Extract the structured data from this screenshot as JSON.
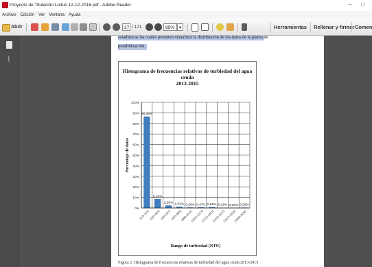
{
  "window": {
    "title": "Proyecto de Titulación Loduo 12-12-2016.pdf - Adobe Reader",
    "minimize": "–",
    "maximize": "□"
  },
  "menu": [
    "Archivo",
    "Edición",
    "Ver",
    "Ventana",
    "Ayuda"
  ],
  "toolbar": {
    "open_label": "Abrir",
    "page_current": "27",
    "page_total": "/ 171",
    "zoom": "85%",
    "tools_label": "Herramientas",
    "sign_label": "Rellenar y firmar",
    "comment_label": "Comenta"
  },
  "document": {
    "line1": "estadísticas las cuales permiten visualizar la distribución de los datos de la planta de",
    "line2": "potabilización.",
    "caption": "Figura 2. Histograma de frecuencias relativas de turbiedad del agua cruda 2013-2015"
  },
  "chart_data": {
    "type": "bar",
    "title": "Histograma de frecuencias relativas de turbiedad del agua cruda 2013-2015",
    "title_lines": [
      "Histograma de frecuencias relativas de turbiedad del agua cruda",
      "2013-2015"
    ],
    "xlabel": "Rango de turbiedad (NTU)",
    "ylabel": "Porcentaje de datos",
    "categories": [
      "[0,8-203]",
      "[203-405]",
      "[405-607]",
      "[607-809]",
      "[809-1011]",
      "[1011-1213]",
      "[1213-1415]",
      "[1415-1617]",
      "[1617-1819]",
      "[1819-2024]"
    ],
    "values": [
      86.38,
      8.26,
      2.25,
      1.03,
      0.38,
      0.47,
      0.66,
      0.19,
      0.09,
      0.28
    ],
    "value_labels": [
      "86,38%",
      "8,26%",
      "2,25%",
      "1,03%",
      "0,38%",
      "0,47%",
      "0,66%",
      "0,19%",
      "0,09%",
      "0,28%"
    ],
    "ylim": [
      0,
      100
    ],
    "yticks": [
      "0%",
      "10%",
      "20%",
      "30%",
      "40%",
      "50%",
      "60%",
      "70%",
      "80%",
      "90%",
      "100%"
    ],
    "grid": true,
    "bar_color": "#3f7fc1"
  }
}
